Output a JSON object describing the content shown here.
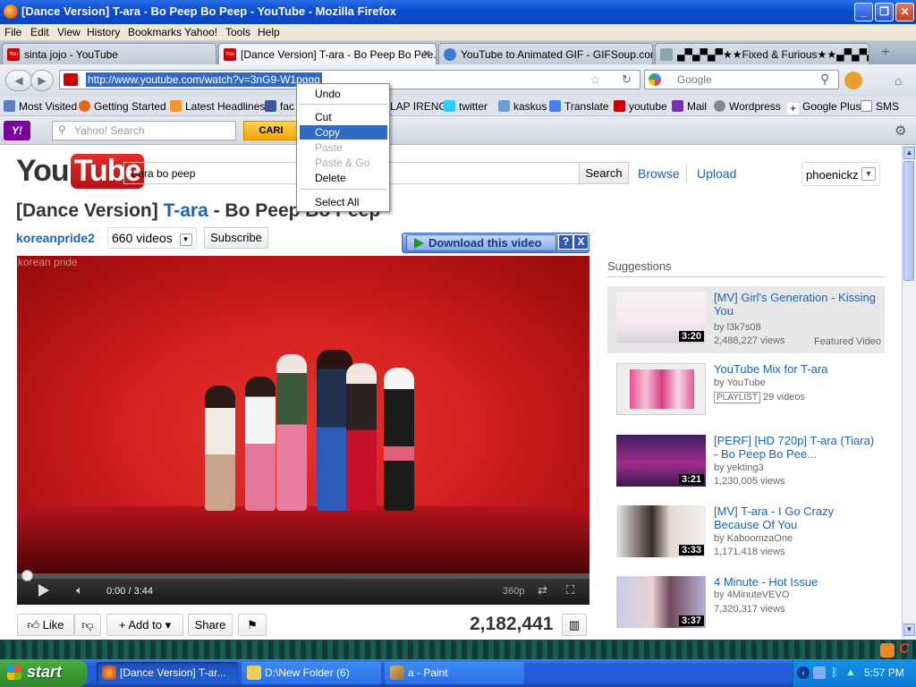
{
  "window": {
    "title": "[Dance Version] T-ara - Bo Peep Bo Peep - YouTube - Mozilla Firefox"
  },
  "menu": [
    "File",
    "Edit",
    "View",
    "History",
    "Bookmarks",
    "Yahoo!",
    "Tools",
    "Help"
  ],
  "tabs": [
    {
      "label": "sinta jojo - YouTube",
      "icon": "youtube-icon"
    },
    {
      "label": "[Dance Version] T-ara - Bo Peep Bo Pee...",
      "icon": "youtube-icon",
      "active": true
    },
    {
      "label": "YouTube to Animated GIF - GIFSoup.com",
      "icon": "gifsoup-icon"
    },
    {
      "label": "▄▀▄▀▄▀★★Fixed & Furious★★▄▀▄▀▄▀",
      "icon": "tab-page-icon"
    }
  ],
  "urlbar": {
    "value": "http://www.youtube.com/watch?v=3nG9-W1pqgg"
  },
  "searchbar": {
    "placeholder": "Google"
  },
  "bookmarks": [
    "Most Visited",
    "Getting Started",
    "Latest Headlines",
    "fac",
    "LAP IRENG",
    "twitter",
    "kaskus",
    "Translate",
    "youtube",
    "Mail",
    "Wordpress",
    "Google Plus",
    "SMS"
  ],
  "yahoo": {
    "search_placeholder": "Yahoo! Search",
    "button": "CARI"
  },
  "context_menu": {
    "items": [
      "Undo",
      "Cut",
      "Copy",
      "Paste",
      "Paste & Go",
      "Delete",
      "Select All"
    ],
    "selected": "Copy",
    "disabled": [
      "Paste",
      "Paste & Go"
    ]
  },
  "youtube": {
    "search_value": "t-ara bo peep",
    "search_button": "Search",
    "browse": "Browse",
    "upload": "Upload",
    "user": "phoenickz",
    "video_title_prefix": "[Dance Version] ",
    "video_title_channel": "T-ara",
    "video_title_suffix": " - Bo Peep Bo Peep",
    "channel": "koreanpride2",
    "video_count": "660 videos",
    "subscribe": "Subscribe",
    "download": "Download this video",
    "download_help": "?",
    "download_close": "X",
    "watermark": "korean pride",
    "time": "0:00 / 3:44",
    "quality": "360p",
    "progress": 0,
    "like": "Like",
    "add_to": "Add to",
    "share": "Share",
    "views": "2,182,441",
    "suggestions_header": "Suggestions",
    "suggestions": [
      {
        "title": "[MV] Girl's Generation - Kissing You",
        "by": "by l3k7s08",
        "views": "2,488,227 views",
        "duration": "3:20",
        "featured": "Featured Video"
      },
      {
        "title": "YouTube Mix for T-ara",
        "by": "by YouTube",
        "playlist": "PLAYLIST",
        "views": "29 videos"
      },
      {
        "title": "[PERF] [HD 720p] T-ara (Tiara) - Bo Peep Bo Pee...",
        "by": "by yekting3",
        "views": "1,230,005 views",
        "duration": "3:21"
      },
      {
        "title": "[MV] T-ara - I Go Crazy Because Of You",
        "by": "by KaboomzaOne",
        "views": "1,171,418 views",
        "duration": "3:33"
      },
      {
        "title": "4 Minute - Hot Issue",
        "by": "by 4MinuteVEVO",
        "views": "7,320,317 views",
        "duration": "3:37"
      }
    ]
  },
  "taskbar": {
    "start": "start",
    "tasks": [
      "[Dance Version] T-ar...",
      "D:\\New Folder (6)",
      "a - Paint"
    ],
    "clock": "5:57 PM"
  },
  "colors": {
    "accent": "#316ac5",
    "youtube_red": "#e52d27",
    "link": "#1c62b9",
    "xp_blue": "#245ddb"
  }
}
